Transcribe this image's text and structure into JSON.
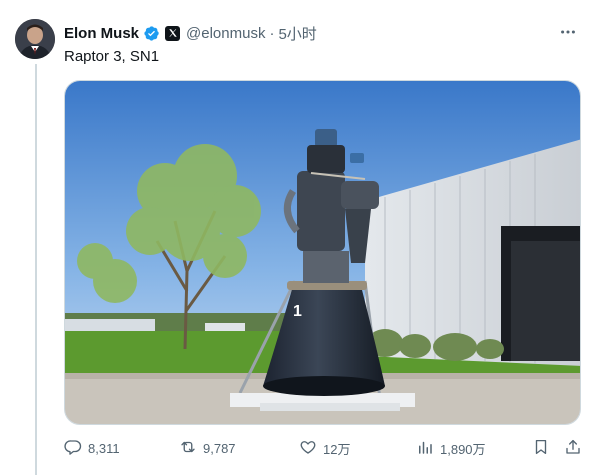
{
  "tweet": {
    "author_name": "Elon Musk",
    "handle": "@elonmusk",
    "separator": "·",
    "time": "5小时",
    "text": "Raptor 3, SN1",
    "engine_mark": "1"
  },
  "actions": {
    "replies": "8,311",
    "reposts": "9,787",
    "likes": "12万",
    "views": "1,890万"
  },
  "icons": {
    "verified": "verified-badge-icon",
    "affiliate": "x-logo-icon",
    "more": "more-icon",
    "reply": "reply-icon",
    "repost": "repost-icon",
    "like": "heart-icon",
    "views": "views-chart-icon",
    "bookmark": "bookmark-icon",
    "share": "share-icon"
  },
  "colors": {
    "verified_blue": "#1d9bf0",
    "text_secondary": "#536471",
    "divider": "#cfd9de"
  }
}
